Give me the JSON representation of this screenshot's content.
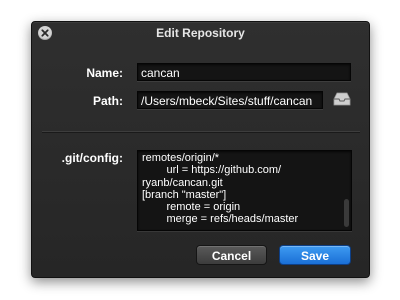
{
  "window": {
    "title": "Edit Repository"
  },
  "form": {
    "name_label": "Name:",
    "name_value": "cancan",
    "path_label": "Path:",
    "path_value": "/Users/mbeck/Sites/stuff/cancan",
    "config_label": ".git/config:",
    "config_value": "remotes/origin/*\n        url = https://github.com/\nryanb/cancan.git\n[branch \"master\"]\n        remote = origin\n        merge = refs/heads/master"
  },
  "buttons": {
    "cancel_label": "Cancel",
    "save_label": "Save"
  },
  "icons": {
    "close": "close-icon",
    "folder": "folder-tray-icon"
  },
  "colors": {
    "window_bg": "#2b2b2b",
    "field_bg": "#141414",
    "save_button": "#2a84e8"
  }
}
